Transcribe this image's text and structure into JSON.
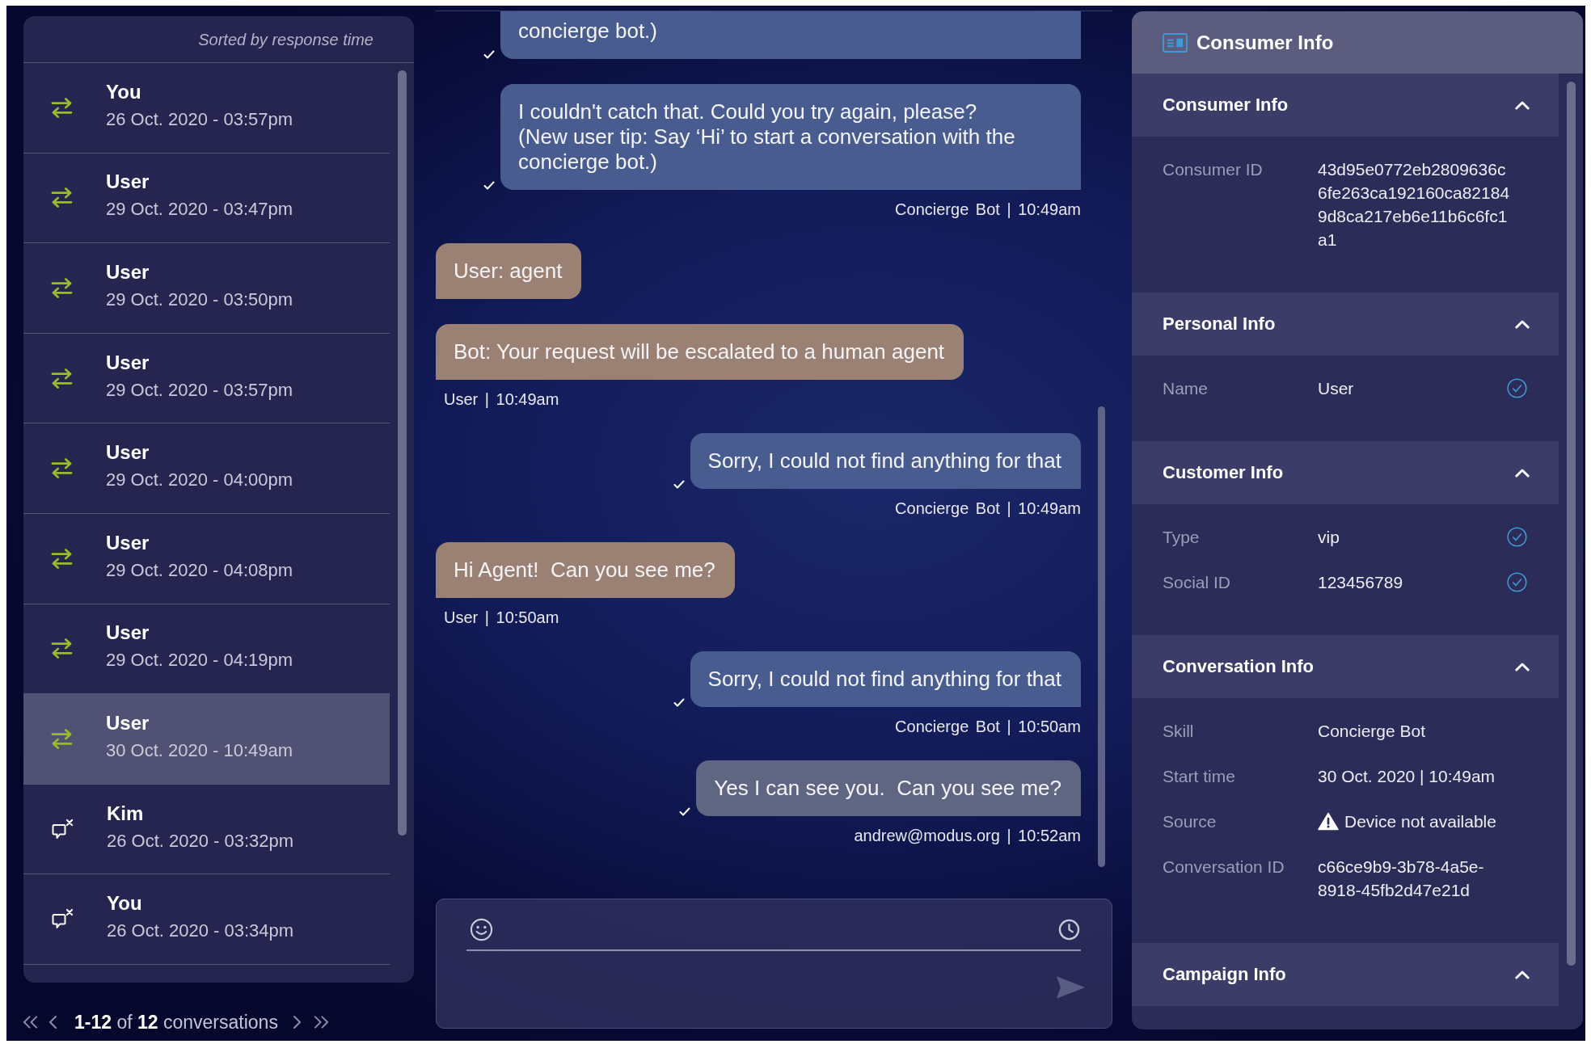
{
  "conversations": {
    "sort_label": "Sorted by response time",
    "rows": [
      {
        "name": "You",
        "time": "26 Oct. 2020 - 03:57pm",
        "kind": "transfer",
        "selected": false
      },
      {
        "name": "User",
        "time": "29 Oct. 2020 - 03:47pm",
        "kind": "transfer",
        "selected": false
      },
      {
        "name": "User",
        "time": "29 Oct. 2020 - 03:50pm",
        "kind": "transfer",
        "selected": false
      },
      {
        "name": "User",
        "time": "29 Oct. 2020 - 03:57pm",
        "kind": "transfer",
        "selected": false
      },
      {
        "name": "User",
        "time": "29 Oct. 2020 - 04:00pm",
        "kind": "transfer",
        "selected": false
      },
      {
        "name": "User",
        "time": "29 Oct. 2020 - 04:08pm",
        "kind": "transfer",
        "selected": false
      },
      {
        "name": "User",
        "time": "29 Oct. 2020 - 04:19pm",
        "kind": "transfer",
        "selected": false
      },
      {
        "name": "User",
        "time": "30 Oct. 2020 - 10:49am",
        "kind": "transfer",
        "selected": true
      },
      {
        "name": "Kim",
        "time": "26 Oct. 2020 - 03:32pm",
        "kind": "closed",
        "selected": false
      },
      {
        "name": "You",
        "time": "26 Oct. 2020 - 03:34pm",
        "kind": "closed",
        "selected": false
      }
    ],
    "pagination": "**1-12** of **12** conversations"
  },
  "chat": {
    "messages": [
      {
        "kind": "bot",
        "text": "concierge bot.)",
        "delivered": true
      },
      {
        "kind": "bot",
        "text": "I couldn't catch that. Could you try again, please?\n(New user tip: Say ‘Hi’ to start a conversation with the concierge bot.)",
        "delivered": true,
        "meta": "Concierge Bot | 10:49am"
      },
      {
        "kind": "consumer",
        "text": "User: agent",
        "delivered": false
      },
      {
        "kind": "consumer",
        "text": "Bot: Your request will be escalated to a human agent",
        "delivered": false,
        "meta": "User | 10:49am"
      },
      {
        "kind": "bot",
        "text": "Sorry, I could not find anything for that",
        "delivered": true,
        "meta": "Concierge Bot | 10:49am"
      },
      {
        "kind": "consumer",
        "text": "Hi Agent!  Can you see me?",
        "delivered": false,
        "meta": "User | 10:50am"
      },
      {
        "kind": "bot",
        "text": "Sorry, I could not find anything for that",
        "delivered": true,
        "meta": "Concierge Bot | 10:50am"
      },
      {
        "kind": "agent",
        "text": "Yes I can see you.  Can you see me?",
        "delivered": true,
        "meta": "andrew@modus.org | 10:52am"
      }
    ],
    "composer": {
      "send_disabled": true
    }
  },
  "consumer_panel": {
    "title": "Consumer Info",
    "sections": [
      {
        "title": "Consumer Info",
        "expanded": true,
        "fields": [
          {
            "label": "Consumer ID",
            "value": "43d95e0772eb2809636c6fe263ca192160ca821849d8ca217eb6e11b6c6fc1a1",
            "kind": "plain"
          }
        ]
      },
      {
        "title": "Personal Info",
        "expanded": true,
        "fields": [
          {
            "label": "Name",
            "value": "User",
            "kind": "verified"
          }
        ]
      },
      {
        "title": "Customer Info",
        "expanded": true,
        "fields": [
          {
            "label": "Type",
            "value": "vip",
            "kind": "verified"
          },
          {
            "label": "Social ID",
            "value": "123456789",
            "kind": "verified"
          }
        ]
      },
      {
        "title": "Conversation Info",
        "expanded": true,
        "fields": [
          {
            "label": "Skill",
            "value": "Concierge Bot",
            "kind": "plain"
          },
          {
            "label": "Start time",
            "value": "30 Oct. 2020 | 10:49am",
            "kind": "plain"
          },
          {
            "label": "Source",
            "value": "Device not available",
            "kind": "alert"
          },
          {
            "label": "Conversation ID",
            "value": "c66ce9b9-3b78-4a5e-8918-45fb2d47e21d",
            "kind": "plain"
          }
        ]
      },
      {
        "title": "Campaign Info",
        "expanded": true
      }
    ]
  }
}
